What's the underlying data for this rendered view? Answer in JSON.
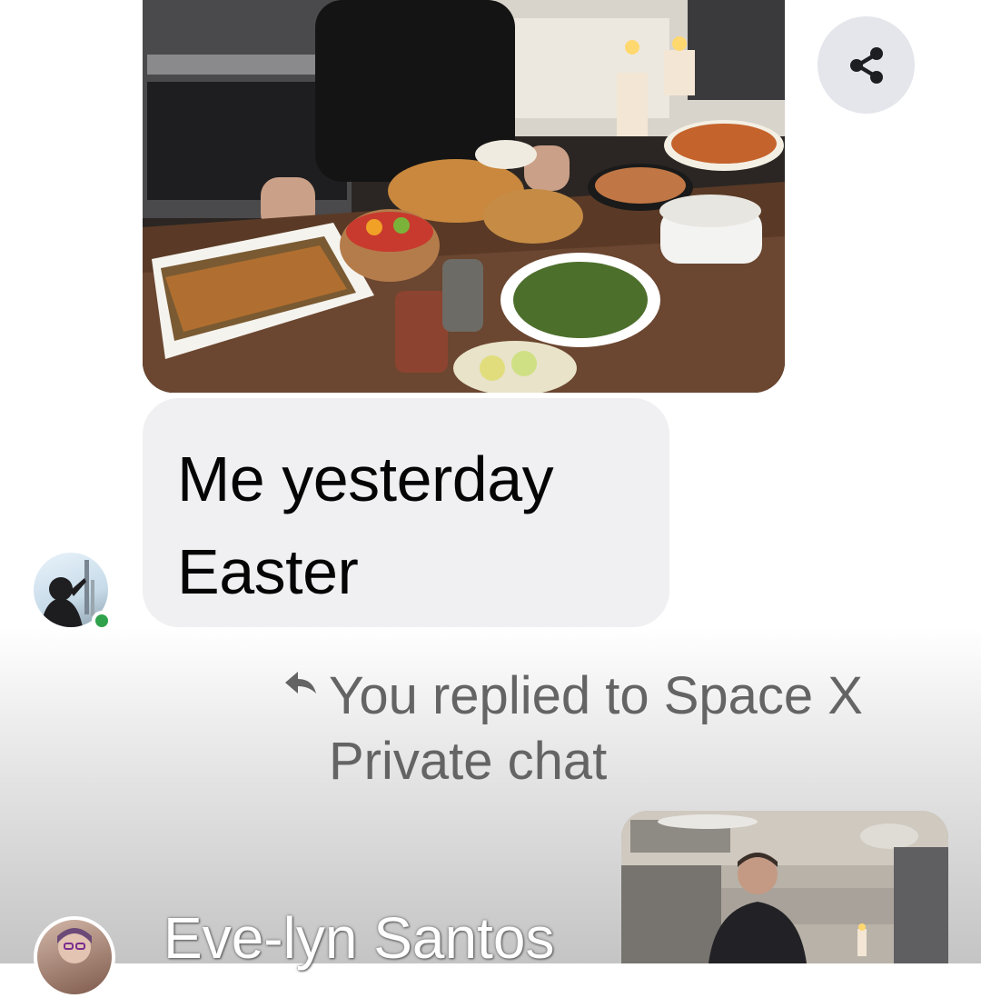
{
  "messages": [
    {
      "kind": "image",
      "icon": "food-photo"
    },
    {
      "kind": "text",
      "lines": [
        "Me yesterday",
        "Easter"
      ]
    }
  ],
  "share": {
    "icon": "share-icon"
  },
  "reply": {
    "icon": "reply-arrow-icon",
    "line1": "You replied to Space X",
    "line2": "Private chat"
  },
  "sender": {
    "name": "Eve-lyn Santos"
  },
  "colors": {
    "bubble": "#f0f0f2",
    "online": "#31a24c",
    "meta_text": "#646464",
    "share_bg": "#e4e6eb"
  }
}
